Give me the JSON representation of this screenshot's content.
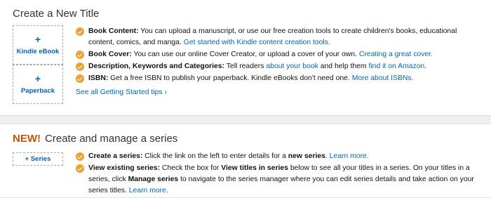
{
  "create_title": {
    "heading": "Create a New Title",
    "formats": [
      {
        "plus": "+",
        "label": "Kindle eBook"
      },
      {
        "plus": "+",
        "label": "Paperback"
      }
    ],
    "tips": {
      "content": {
        "label": "Book Content:",
        "text": " You can upload a manuscript, or use our free creation tools to create children's books, educational content, comics, and manga. ",
        "link": "Get started with Kindle content creation tools."
      },
      "cover": {
        "label": "Book Cover:",
        "text": " You can use our online Cover Creator, or upload a cover of your own. ",
        "link": "Creating a great cover."
      },
      "keywords": {
        "label": "Description, Keywords and Categories:",
        "text1": " Tell readers ",
        "link1": "about your book",
        "text2": " and help them ",
        "link2": "find it on Amazon",
        "text3": "."
      },
      "isbn": {
        "label": "ISBN:",
        "text": " Get a free ISBN to publish your paperback. Kindle eBooks don't need one. ",
        "link": "More about ISBNs."
      }
    },
    "see_all": "See all Getting Started tips ›"
  },
  "series": {
    "new_tag": "NEW!",
    "heading": "Create and manage a series",
    "button": "+ Series",
    "tips": {
      "create": {
        "label": "Create a series:",
        "text1": " Click the link on the left to enter details for a ",
        "bold1": "new series",
        "text2": ". ",
        "link": "Learn more."
      },
      "existing": {
        "label": "View existing series:",
        "text1": " Check the box for ",
        "bold1": "View titles in series",
        "text2": " below to see all your titles in a series. On your titles in a series, click ",
        "bold2": "Manage series",
        "text3": " to navigate to the series manager where you can edit series details and take action on your series titles. ",
        "link": "Learn more."
      }
    }
  },
  "colors": {
    "link": "#0066c0",
    "check": "#f0a030",
    "new_tag": "#c45500"
  },
  "icons": {
    "check": "orange-check-circle-icon"
  }
}
